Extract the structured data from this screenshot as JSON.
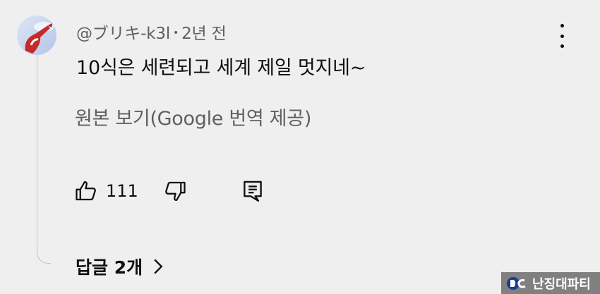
{
  "comment": {
    "author": "@ブリキ-k3l",
    "separator": "•",
    "time_ago": "2년 전",
    "text": "10식은 세련되고 세계 제일 멋지네~",
    "translate_label": "원본 보기(Google 번역 제공)"
  },
  "actions": {
    "like_count": "111",
    "like_icon": "thumbs-up-icon",
    "dislike_icon": "thumbs-down-icon",
    "reply_icon": "comment-icon",
    "more_icon": "vertical-ellipsis-icon"
  },
  "replies": {
    "label": "답글 2개",
    "icon": "chevron-right-icon"
  },
  "watermark": {
    "text": "난징대파티",
    "logo": "dc-logo"
  },
  "colors": {
    "background": "#efefef",
    "primary_text": "#0f0f0f",
    "secondary_text": "#606060",
    "thread_line": "#c4c4c4",
    "watermark_bg": "#808080"
  }
}
